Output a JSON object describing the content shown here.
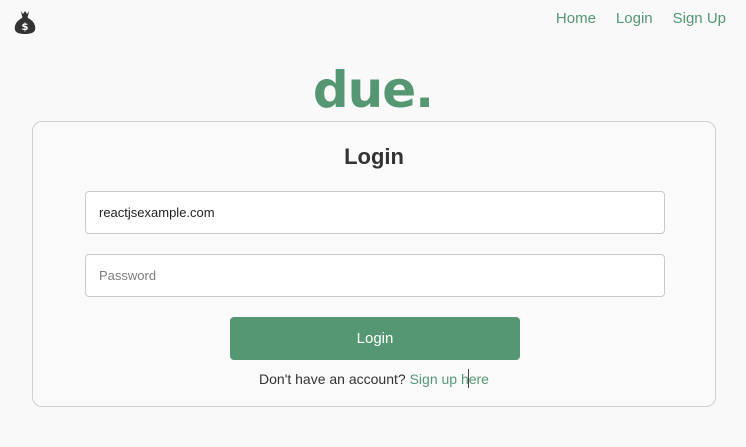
{
  "navbar": {
    "logo_icon": "money-bag-icon",
    "links": [
      "Home",
      "Login",
      "Sign Up"
    ]
  },
  "brand": "due.",
  "login_card": {
    "title": "Login",
    "email_value": "reactjsexample.com",
    "password_placeholder": "Password",
    "submit_label": "Login",
    "signup_prompt": "Don't have an account?",
    "signup_link": "Sign up here"
  },
  "colors": {
    "accent": "#559673",
    "background": "#f9f9f9",
    "text": "#333333"
  }
}
